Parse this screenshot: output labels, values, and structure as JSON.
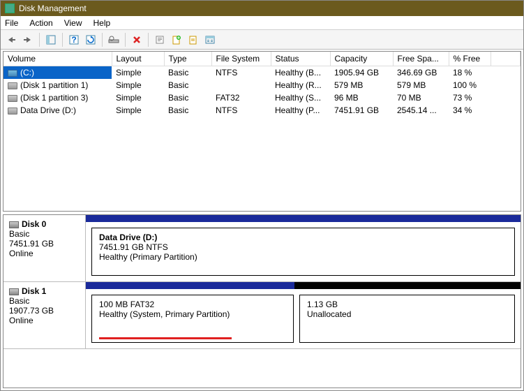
{
  "title": "Disk Management",
  "menus": [
    "File",
    "Action",
    "View",
    "Help"
  ],
  "columns": [
    "Volume",
    "Layout",
    "Type",
    "File System",
    "Status",
    "Capacity",
    "Free Spa...",
    "% Free"
  ],
  "volumes": [
    {
      "icon": "blue",
      "name": "(C:)",
      "layout": "Simple",
      "type": "Basic",
      "fs": "NTFS",
      "status": "Healthy (B...",
      "capacity": "1905.94 GB",
      "free": "346.69 GB",
      "pct": "18 %",
      "selected": true
    },
    {
      "icon": "gray",
      "name": "(Disk 1 partition 1)",
      "layout": "Simple",
      "type": "Basic",
      "fs": "",
      "status": "Healthy (R...",
      "capacity": "579 MB",
      "free": "579 MB",
      "pct": "100 %",
      "selected": false
    },
    {
      "icon": "gray",
      "name": "(Disk 1 partition 3)",
      "layout": "Simple",
      "type": "Basic",
      "fs": "FAT32",
      "status": "Healthy (S...",
      "capacity": "96 MB",
      "free": "70 MB",
      "pct": "73 %",
      "selected": false
    },
    {
      "icon": "gray",
      "name": "Data Drive (D:)",
      "layout": "Simple",
      "type": "Basic",
      "fs": "NTFS",
      "status": "Healthy (P...",
      "capacity": "7451.91 GB",
      "free": "2545.14 ...",
      "pct": "34 %",
      "selected": false
    }
  ],
  "disks": [
    {
      "name": "Disk 0",
      "type": "Basic",
      "size": "7451.91 GB",
      "state": "Online",
      "bars": [
        {
          "color": "#1a2a9a",
          "flex": 1
        }
      ],
      "partitions": [
        {
          "name": "Data Drive  (D:)",
          "line2": "7451.91 GB NTFS",
          "line3": "Healthy (Primary Partition)",
          "flex": "1",
          "underline": false
        }
      ]
    },
    {
      "name": "Disk 1",
      "type": "Basic",
      "size": "1907.73 GB",
      "state": "Online",
      "bars": [
        {
          "color": "#1a2a9a",
          "flex": 0.48
        },
        {
          "color": "#000",
          "flex": 0.52
        }
      ],
      "partitions": [
        {
          "name": "",
          "line2": "100 MB FAT32",
          "line3": "Healthy (System, Primary Partition)",
          "flex": "0 0 290px",
          "underline": true,
          "ulwidth": "190px"
        },
        {
          "name": "",
          "line2": "1.13 GB",
          "line3": "Unallocated",
          "flex": "1",
          "underline": false,
          "class": "unalloc"
        }
      ]
    }
  ]
}
